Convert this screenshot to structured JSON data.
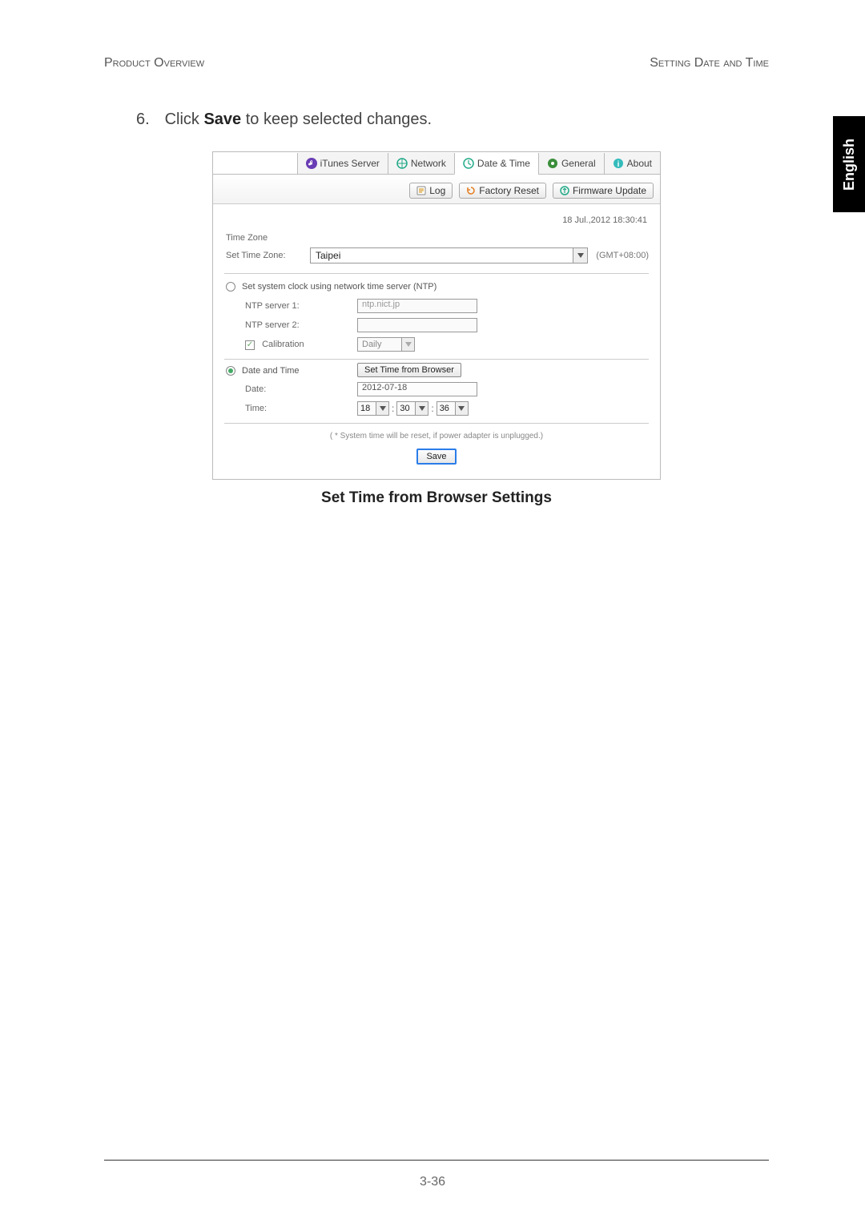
{
  "header": {
    "left": "Product Overview",
    "right": "Setting Date and Time"
  },
  "sideTab": "English",
  "instruction": {
    "number": "6.",
    "pre": "Click ",
    "bold": "Save",
    "post": " to keep selected changes."
  },
  "tabs": {
    "itunes": "iTunes Server",
    "network": "Network",
    "datetime": "Date & Time",
    "general": "General",
    "about": "About"
  },
  "subtabs": {
    "log": "Log",
    "factory": "Factory Reset",
    "firmware": "Firmware Update"
  },
  "clock": "18 Jul.,2012 18:30:41",
  "tz": {
    "section": "Time Zone",
    "label": "Set Time Zone:",
    "value": "Taipei",
    "gmt": "(GMT+08:00)"
  },
  "ntp": {
    "radioLabel": "Set system clock using network time server (NTP)",
    "server1Label": "NTP server 1:",
    "server1Value": "ntp.nict.jp",
    "server2Label": "NTP server 2:",
    "server2Value": "",
    "calibLabel": "Calibration",
    "calibValue": "Daily"
  },
  "dt": {
    "radioLabel": "Date and Time",
    "buttonLabel": "Set Time from Browser",
    "dateLabel": "Date:",
    "dateValue": "2012-07-18",
    "timeLabel": "Time:",
    "hh": "18",
    "mm": "30",
    "ss": "36",
    "colon": ":"
  },
  "note": "( * System time will be reset, if power adapter is unplugged.)",
  "saveLabel": "Save",
  "caption": "Set Time from Browser Settings",
  "pageNumber": "3-36"
}
